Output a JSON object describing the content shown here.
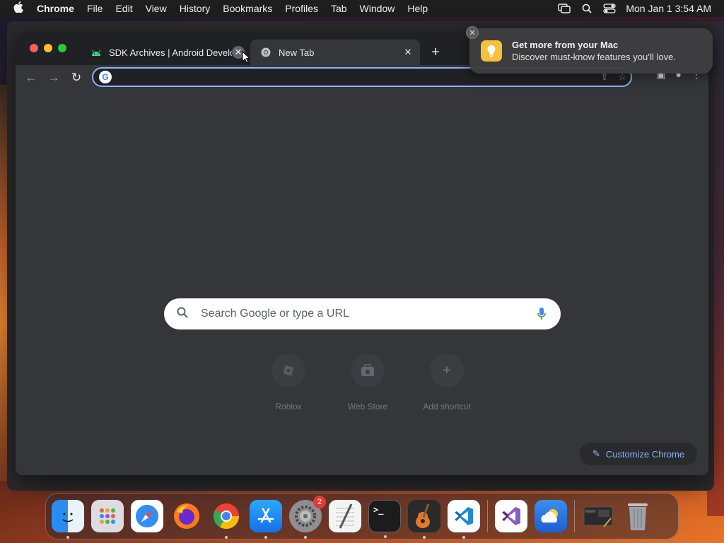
{
  "menubar": {
    "app": "Chrome",
    "items": [
      "File",
      "Edit",
      "View",
      "History",
      "Bookmarks",
      "Profiles",
      "Tab",
      "Window",
      "Help"
    ],
    "datetime": "Mon Jan 1  3:54 AM"
  },
  "tabs": [
    {
      "title": "SDK Archives  |  Android Develo",
      "icon": "android-icon"
    },
    {
      "title": "New Tab",
      "icon": "chrome-icon",
      "active": true
    }
  ],
  "omnibox": {
    "value": "",
    "placeholder": ""
  },
  "search": {
    "placeholder": "Search Google or type a URL"
  },
  "shortcuts": [
    {
      "label": "Roblox",
      "icon": "roblox-icon"
    },
    {
      "label": "Web Store",
      "icon": "webstore-icon"
    },
    {
      "label": "Add shortcut",
      "icon": "plus-icon"
    }
  ],
  "customize": {
    "label": "Customize Chrome"
  },
  "notification": {
    "title": "Get more from your Mac",
    "body": "Discover must-know features you’ll love."
  },
  "dock": {
    "items": [
      {
        "name": "finder",
        "color": "#2a8cf0",
        "running": true
      },
      {
        "name": "launchpad",
        "color": "#d0d0d8",
        "running": false
      },
      {
        "name": "safari",
        "color": "#2f7ff0",
        "running": false
      },
      {
        "name": "firefox",
        "color": "#ff7a1a",
        "running": false
      },
      {
        "name": "chrome",
        "color": "#ffffff",
        "running": true
      },
      {
        "name": "app-store",
        "color": "#1f8ef5",
        "running": true
      },
      {
        "name": "system-settings",
        "color": "#8e8e93",
        "running": true,
        "badge": "2"
      },
      {
        "name": "textedit",
        "color": "#f2f2f2",
        "running": false
      },
      {
        "name": "terminal",
        "color": "#1c1c1c",
        "running": true
      },
      {
        "name": "garageband",
        "color": "#3a3a3a",
        "running": true
      },
      {
        "name": "vscode",
        "color": "#ffffff",
        "running": true
      },
      {
        "name": "visual-studio",
        "color": "#ffffff",
        "running": false
      },
      {
        "name": "weather",
        "color": "#2e7fe0",
        "running": false
      },
      {
        "name": "preview-window",
        "color": "#3a3a3a",
        "running": false
      },
      {
        "name": "trash",
        "color": "#9a9aa0",
        "running": false
      }
    ]
  }
}
